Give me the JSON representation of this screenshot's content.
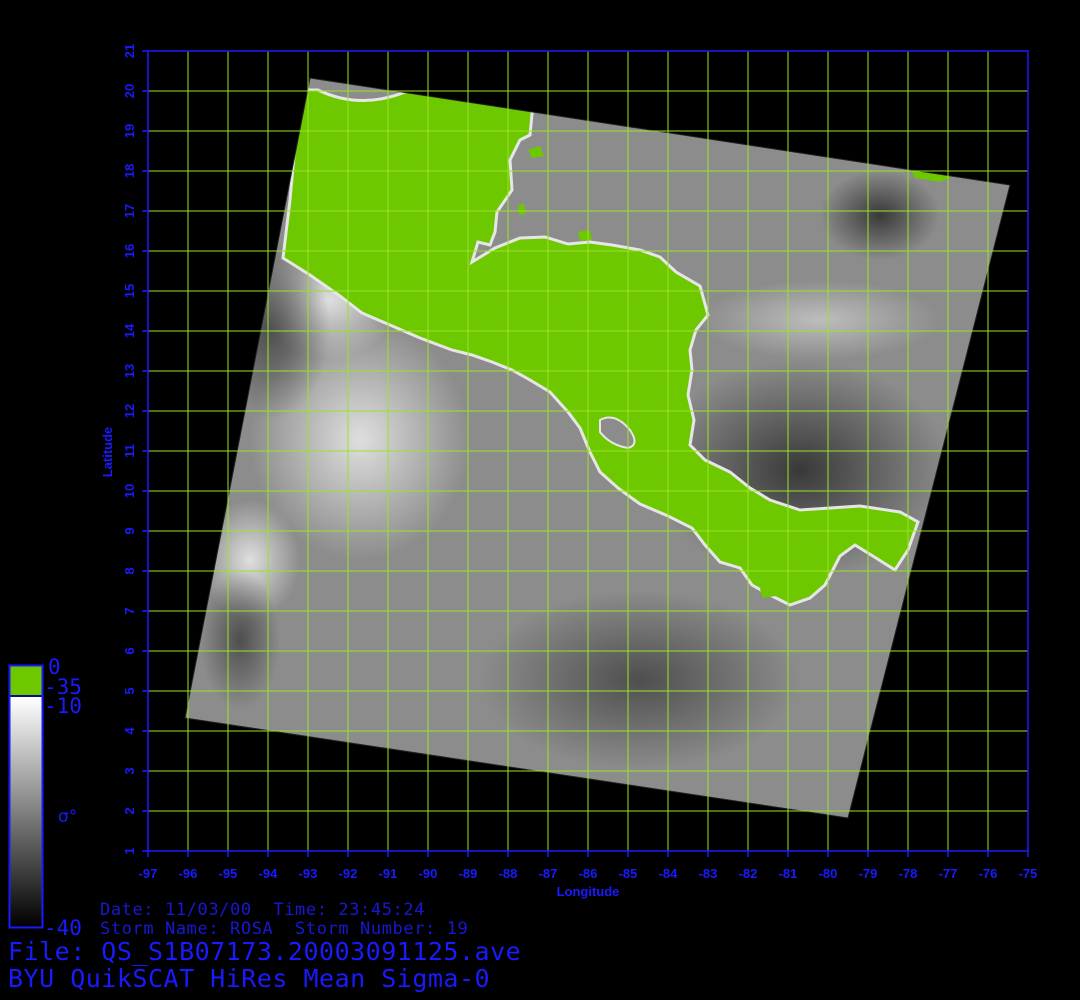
{
  "map": {
    "xlabel": "Longitude",
    "ylabel": "Latitude",
    "lon_range": [
      -97,
      -75
    ],
    "lat_range": [
      1,
      21
    ],
    "lon_ticks": [
      "-97",
      "-96",
      "-95",
      "-94",
      "-93",
      "-92",
      "-91",
      "-90",
      "-89",
      "-88",
      "-87",
      "-86",
      "-85",
      "-84",
      "-83",
      "-82",
      "-81",
      "-80",
      "-79",
      "-78",
      "-77",
      "-76",
      "-75"
    ],
    "lat_ticks": [
      "1",
      "2",
      "3",
      "4",
      "5",
      "6",
      "7",
      "8",
      "9",
      "10",
      "11",
      "12",
      "13",
      "14",
      "15",
      "16",
      "17",
      "18",
      "19",
      "20",
      "21"
    ],
    "grid": true,
    "colors": {
      "axis": "#1a1aff",
      "grid": "#9be22a",
      "land": "#6ec800",
      "background": "#000000"
    }
  },
  "colorbar": {
    "labels": [
      "0",
      "-35",
      "-10",
      "-40"
    ],
    "symbol": "σ°"
  },
  "info": {
    "date_line": "Date: 11/03/00  Time: 23:45:24",
    "storm_line": "Storm Name: ROSA  Storm Number: 19",
    "file_line": "File: QS_S1B07173.20003091125.ave",
    "title_line": "BYU QuikSCAT HiRes Mean Sigma-0"
  }
}
